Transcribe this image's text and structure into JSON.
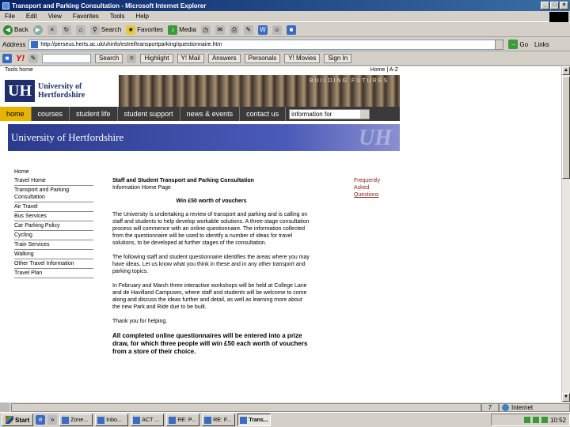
{
  "window": {
    "title": "Transport and Parking Consultation - Microsoft Internet Explorer",
    "controls": [
      "_",
      "□",
      "×"
    ]
  },
  "menubar": [
    "File",
    "Edit",
    "View",
    "Favorites",
    "Tools",
    "Help"
  ],
  "toolbar": {
    "back": "Back",
    "forward": "",
    "search": "Search",
    "favorites": "Favorites",
    "media": "Media"
  },
  "addressbar": {
    "label": "Address",
    "url": "http://perseus.herts.ac.uk/uhinfo/estrel/transportparking/questionnaire.htm",
    "go": "Go",
    "links": "Links"
  },
  "yahoobar": {
    "logo": "Y!",
    "search_btn": "Search",
    "highlight": "Highlight",
    "mail": "Y! Mail",
    "answers": "Answers",
    "personals": "Personals",
    "movies": "Y! Movies",
    "signin": "Sign In"
  },
  "page": {
    "tools_left": "Tools home",
    "tools_right": "Home | A-Z",
    "logo_mark": "UH",
    "logo_name_1": "University of",
    "logo_name_2": "Hertfordshire",
    "building_futures": "BUILDING FUTURES",
    "nav": [
      "home",
      "courses",
      "student life",
      "student support",
      "news & events",
      "contact us"
    ],
    "info_for": "information for",
    "banner_title": "University of Hertfordshire",
    "banner_wm": "UH",
    "leftnav": [
      "Home",
      "Travel Home",
      "Transport and Parking Consultation",
      "Air Travel",
      "Bus Services",
      "Car Parking Policy",
      "Cycling",
      "Train Services",
      "Walking",
      "Other Travel Information",
      "Travel Plan"
    ],
    "content": {
      "heading_1": "Staff and Student Transport and Parking Consultation",
      "heading_2": "Information Home Page",
      "win": "Win £50 worth of vouchers",
      "p1": "The University is undertaking a review of transport and parking and is calling on staff and students to help develop workable solutions. A three-stage consultation process will commence with an online questionnaire. The information collected from the questionnaire will be used to identify a number of ideas for travel solutions, to be developed at further stages of the consultation.",
      "p2": "The following staff and student questionnaire identifies the areas where you may have ideas. Let us know what you think in these and in any other transport and parking topics.",
      "p3": "In February and March three interactive workshops will be held at College Lane and de Havilland Campuses, where staff and students will be welcome to come along and discuss the ideas further and detail, as well as learning more about the new Park and Ride due to be built.",
      "p4": "Thank you for helping.",
      "prize": "All completed online questionnaires will be entered into a prize draw, for which three people will win £50 each worth of vouchers from a store of their choice."
    },
    "faq": [
      "Frequently",
      "Asked",
      "Questions"
    ]
  },
  "statusbar": {
    "number": "7",
    "zone": "Internet"
  },
  "taskbar": {
    "start": "Start",
    "tasks": [
      "Zone...",
      "Inbo...",
      "ACT ...",
      "RE: P...",
      "RE: F...",
      "Trans..."
    ],
    "active_index": 5,
    "clock": "10:52"
  }
}
